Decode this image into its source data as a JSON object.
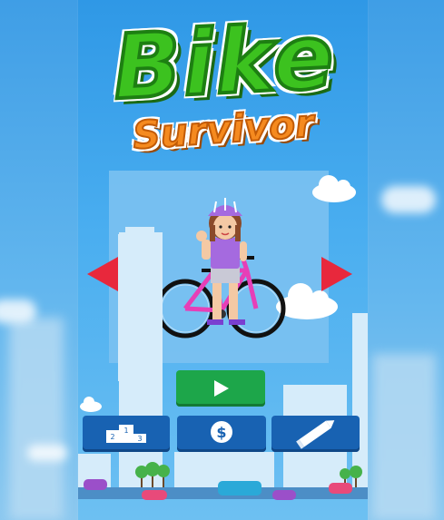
{
  "game": {
    "title_main": "Bike",
    "title_sub": "Survivor"
  },
  "character_select": {
    "prev_icon": "triangle-left-icon",
    "next_icon": "triangle-right-icon",
    "arrow_color": "#e8283c"
  },
  "menu": {
    "play_icon": "play-icon",
    "leaderboard_icon": "podium-icon",
    "leaderboard_places": [
      "2",
      "1",
      "3"
    ],
    "shop_icon": "dollar-coin-icon",
    "shop_symbol": "$",
    "edit_icon": "pencil-icon"
  },
  "colors": {
    "logo_green": "#3cc21f",
    "logo_orange": "#f58a1f",
    "play_green": "#1da64a",
    "menu_blue": "#1862b2",
    "sky": "#4aaef0"
  }
}
